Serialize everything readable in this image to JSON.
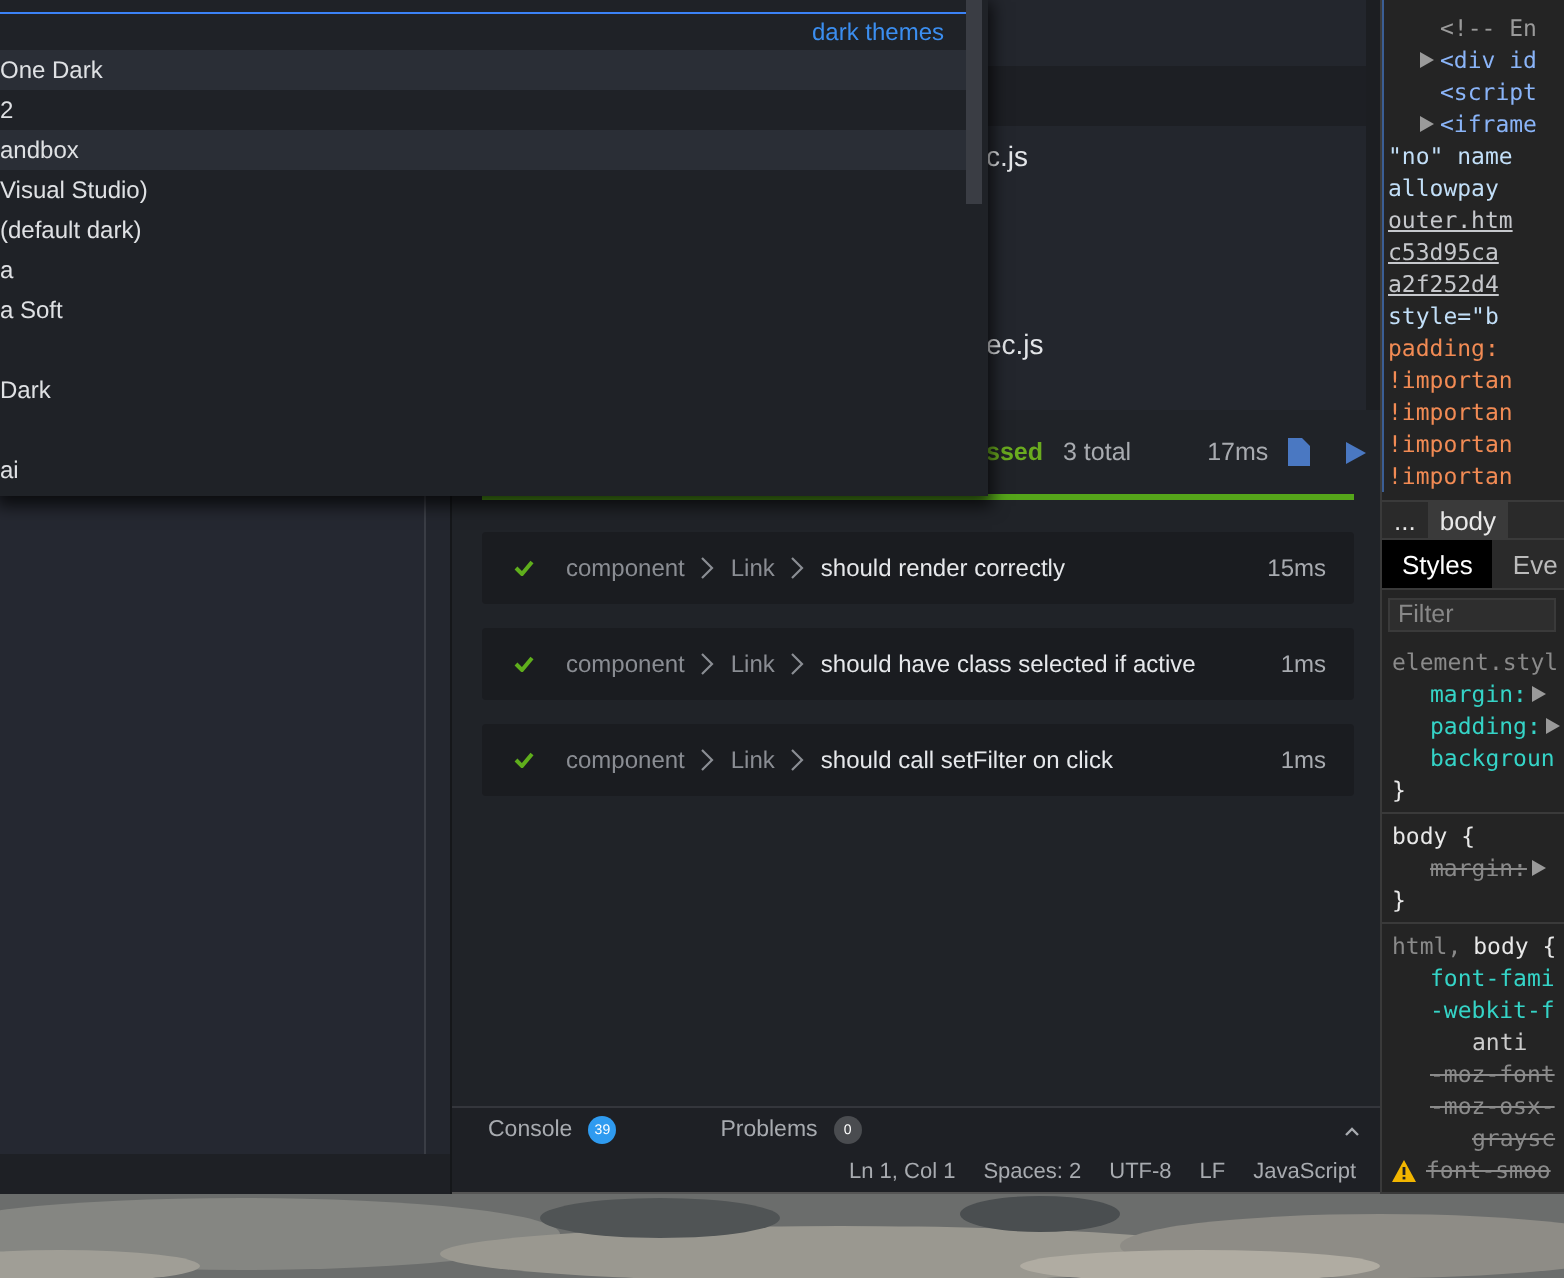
{
  "theme_dropdown": {
    "section_label": "dark themes",
    "items": [
      {
        "kind": "theme",
        "label": "One Dark",
        "highlighted": true
      },
      {
        "kind": "theme",
        "label": "2",
        "highlighted": false
      },
      {
        "kind": "theme",
        "label": "andbox",
        "highlighted": true
      },
      {
        "kind": "theme",
        "label": "Visual Studio)",
        "highlighted": false
      },
      {
        "kind": "theme",
        "label": "(default dark)",
        "highlighted": false
      },
      {
        "kind": "theme",
        "label": "a",
        "highlighted": false
      },
      {
        "kind": "theme",
        "label": "a Soft",
        "highlighted": false
      },
      {
        "kind": "blank",
        "highlighted": false
      },
      {
        "kind": "theme",
        "label": "Dark",
        "highlighted": false
      },
      {
        "kind": "blank",
        "highlighted": false
      },
      {
        "kind": "theme",
        "label": "ai",
        "highlighted": false
      }
    ]
  },
  "files": [
    {
      "name": "c.js"
    },
    {
      "name": "ec.js"
    }
  ],
  "test_summary": {
    "status": "ssed",
    "total": "3 total",
    "duration": "17ms",
    "level": 1
  },
  "tests": [
    {
      "path": [
        "component",
        "Link"
      ],
      "name": "should render correctly",
      "duration": "15ms",
      "passed": true
    },
    {
      "path": [
        "component",
        "Link"
      ],
      "name": "should have class selected if active",
      "duration": "1ms",
      "passed": true
    },
    {
      "path": [
        "component",
        "Link"
      ],
      "name": "should call setFilter on click",
      "duration": "1ms",
      "passed": true
    }
  ],
  "bottom_tabs": [
    {
      "label": "Console",
      "count": "39",
      "color": "#2f9bf0",
      "selected": false
    },
    {
      "label": "Problems",
      "count": "0",
      "color": "#4a4c50",
      "selected": false
    }
  ],
  "status_bar": [
    "Ln 1, Col 1",
    "Spaces: 2",
    "UTF-8",
    "LF",
    "JavaScript"
  ],
  "devtools": {
    "elements": [
      {
        "text": "<!-- En",
        "kind": "comment",
        "expander": false,
        "indent": true
      },
      {
        "text": "<div id",
        "kind": "tag",
        "expander": true,
        "indent": true
      },
      {
        "text": "<script",
        "kind": "tag",
        "expander": false,
        "indent": true
      },
      {
        "text": "<iframe",
        "kind": "tag",
        "expander": true,
        "indent": true
      },
      {
        "text": "\"no\" name",
        "kind": "attr",
        "expander": false,
        "indent": false
      },
      {
        "text": "allowpay",
        "kind": "attr",
        "expander": false,
        "indent": false
      },
      {
        "text": "outer.htm",
        "kind": "link",
        "expander": false,
        "indent": false
      },
      {
        "text": "c53d95ca",
        "kind": "link",
        "expander": false,
        "indent": false
      },
      {
        "text": "a2f252d4",
        "kind": "link",
        "expander": false,
        "indent": false
      },
      {
        "text": "style=\"b",
        "kind": "attr",
        "expander": false,
        "indent": false
      },
      {
        "text": "padding:",
        "kind": "value",
        "expander": false,
        "indent": false
      },
      {
        "text": "!importan",
        "kind": "value",
        "expander": false,
        "indent": false
      },
      {
        "text": "!importan",
        "kind": "value",
        "expander": false,
        "indent": false
      },
      {
        "text": "!importan",
        "kind": "value",
        "expander": false,
        "indent": false
      },
      {
        "text": "!importan",
        "kind": "value",
        "expander": false,
        "indent": false
      }
    ],
    "breadcrumb": {
      "more": "...",
      "items": [
        {
          "label": "body",
          "selected": true
        }
      ]
    },
    "tabs": [
      {
        "label": "Styles",
        "selected": true
      },
      {
        "label": "Eve",
        "selected": false
      }
    ],
    "filter": {
      "placeholder": "Filter"
    },
    "rules": [
      {
        "lines": [
          {
            "parts": [
              {
                "text": "element.styl",
                "kind": "dim"
              }
            ],
            "expander": false,
            "struck": false,
            "warning": false
          },
          {
            "parts": [
              {
                "text": "margin:",
                "kind": "prop"
              }
            ],
            "expander": true,
            "struck": false,
            "warning": false
          },
          {
            "parts": [
              {
                "text": "padding:",
                "kind": "prop"
              }
            ],
            "expander": true,
            "struck": false,
            "warning": false
          },
          {
            "parts": [
              {
                "text": "backgroun",
                "kind": "prop"
              }
            ],
            "expander": false,
            "struck": false,
            "warning": false
          },
          {
            "parts": [
              {
                "text": "}",
                "kind": "selector"
              }
            ],
            "expander": false,
            "struck": false,
            "warning": false
          }
        ]
      },
      {
        "lines": [
          {
            "parts": [
              {
                "text": "body {",
                "kind": "selector"
              }
            ],
            "expander": false,
            "struck": false,
            "warning": false
          },
          {
            "parts": [
              {
                "text": "margin:",
                "kind": "prop"
              }
            ],
            "expander": true,
            "struck": true,
            "warning": false
          },
          {
            "parts": [
              {
                "text": "}",
                "kind": "selector"
              }
            ],
            "expander": false,
            "struck": false,
            "warning": false
          }
        ]
      },
      {
        "lines": [
          {
            "parts": [
              {
                "text": "html,",
                "kind": "dim"
              },
              {
                "text": "body {",
                "kind": "selector"
              }
            ],
            "expander": false,
            "struck": false,
            "warning": false
          },
          {
            "parts": [
              {
                "text": "font-fami",
                "kind": "prop"
              }
            ],
            "expander": false,
            "struck": false,
            "warning": false
          },
          {
            "parts": [
              {
                "text": "-webkit-f",
                "kind": "prop"
              }
            ],
            "expander": false,
            "struck": false,
            "warning": false
          },
          {
            "parts": [
              {
                "text": "anti",
                "kind": "cont"
              }
            ],
            "expander": false,
            "struck": false,
            "warning": false
          },
          {
            "parts": [
              {
                "text": "-moz-font",
                "kind": "prop"
              }
            ],
            "expander": false,
            "struck": true,
            "warning": false
          },
          {
            "parts": [
              {
                "text": "-moz-osx-",
                "kind": "prop"
              }
            ],
            "expander": false,
            "struck": true,
            "warning": false
          },
          {
            "parts": [
              {
                "text": "graysc",
                "kind": "cont"
              }
            ],
            "expander": false,
            "struck": true,
            "warning": false
          },
          {
            "parts": [
              {
                "text": "font-smoo",
                "kind": "prop"
              }
            ],
            "expander": false,
            "struck": true,
            "warning": true
          }
        ]
      }
    ]
  }
}
